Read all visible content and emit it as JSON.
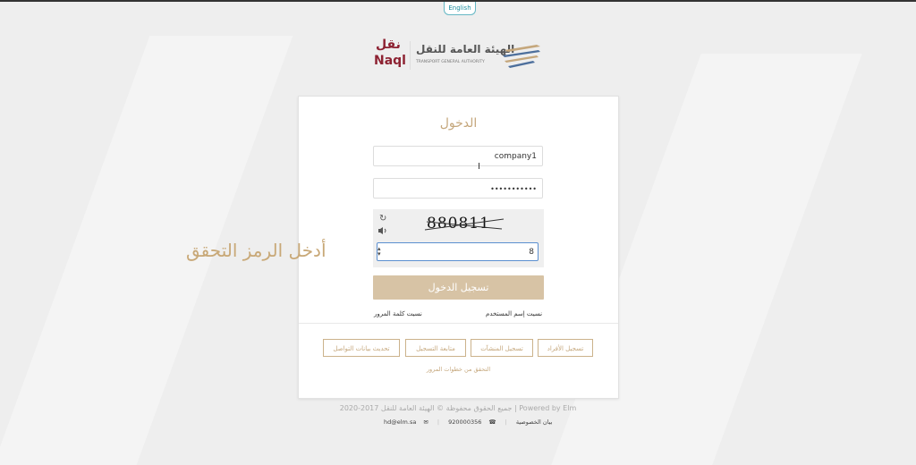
{
  "header": {
    "language_button": "English"
  },
  "logo": {
    "naql_arabic": "نقل",
    "naql_english": "Naql",
    "authority_arabic": "الهيئة العامة للنقل",
    "authority_english": "TRANSPORT GENERAL AUTHORITY"
  },
  "login": {
    "title": "الدخول",
    "username_value": "company1",
    "password_value": "•••••••••••",
    "captcha_code": "880811",
    "captcha_input_value": "8",
    "submit_label": "تسجيل الدخول",
    "forgot_username": "نسيت إسم المستخدم",
    "forgot_password": "نسيت كلمة المرور"
  },
  "registration": {
    "buttons": [
      "تسجيل الأفراد",
      "تسجيل المنشآت",
      "متابعة التسجيل",
      "تحديث بيانات التواصل"
    ],
    "verify_steps_link": "التحقق من خطوات المرور"
  },
  "callout": {
    "text": "أدخل الرمز التحقق"
  },
  "footer": {
    "copyright": "جميع الحقوق محفوظة © الهيئة العامة للنقل 2017-2020 | Powered by Elm",
    "privacy": "بيان الخصوصية",
    "phone": "920000356",
    "email": "hd@elm.sa"
  },
  "colors": {
    "gold": "#c5a77c",
    "button_disabled": "#d7c3a5",
    "naql_red": "#8d2232"
  }
}
